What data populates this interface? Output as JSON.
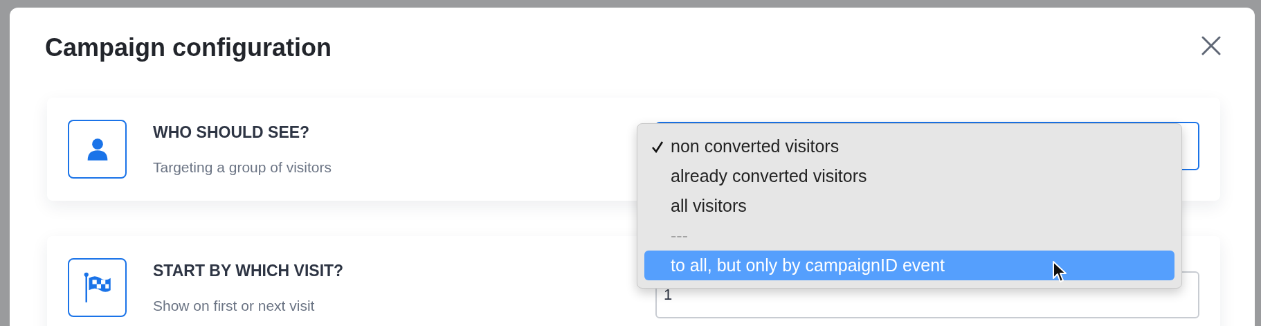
{
  "dialog": {
    "title": "Campaign configuration"
  },
  "sections": [
    {
      "kind": "select",
      "heading": "WHO SHOULD SEE?",
      "description": "Targeting a group of visitors",
      "focused": true
    },
    {
      "kind": "input",
      "heading": "START BY WHICH VISIT?",
      "description": "Show on first or next visit",
      "value": "1",
      "focused": false
    }
  ],
  "dropdown": {
    "options": [
      {
        "kind": "option",
        "label": "non converted visitors",
        "checked": true,
        "selected": false
      },
      {
        "kind": "option",
        "label": "already converted visitors",
        "checked": false,
        "selected": false
      },
      {
        "kind": "option",
        "label": "all visitors",
        "checked": false,
        "selected": false
      },
      {
        "kind": "separator",
        "label": "---"
      },
      {
        "kind": "option",
        "label": "to all, but only by campaignID event",
        "checked": false,
        "selected": true
      }
    ]
  }
}
